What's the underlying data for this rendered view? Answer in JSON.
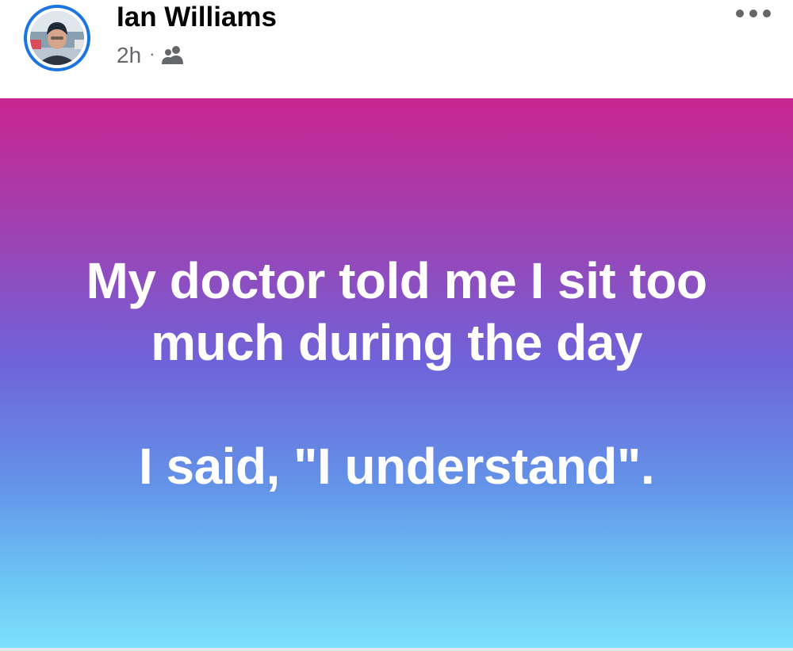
{
  "post": {
    "author": {
      "name": "Ian Williams",
      "avatar_icon": "profile-photo"
    },
    "meta": {
      "time": "2h",
      "separator": "·",
      "audience_icon": "friends-icon"
    },
    "more_icon": "more-options-icon",
    "body": {
      "lines": [
        "My doctor told me I sit too",
        "much during the day",
        "I said, \"I understand\"."
      ],
      "background_gradient": [
        "#c92590",
        "#9945b6",
        "#6f63da",
        "#6392e8",
        "#6cc6f4",
        "#7ce0fb"
      ],
      "text_color": "#ffffff"
    },
    "colors": {
      "avatar_ring": "#1b74e4",
      "name": "#050505",
      "meta": "#65676b"
    }
  }
}
